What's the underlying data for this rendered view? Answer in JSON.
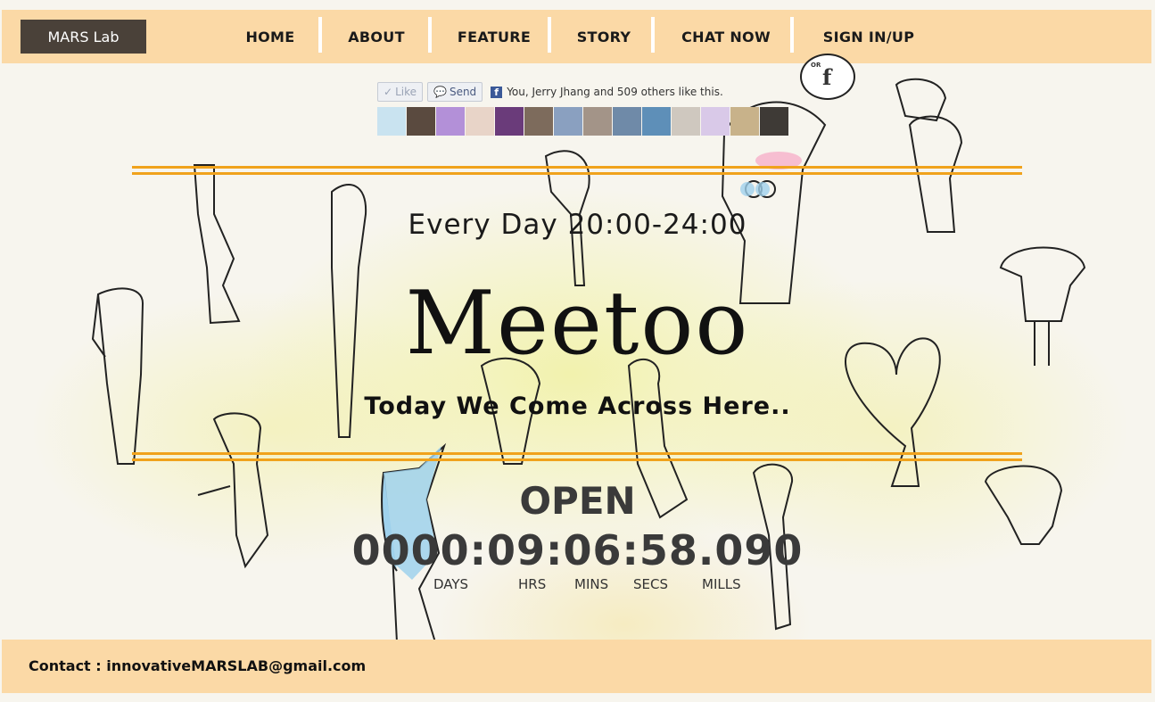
{
  "nav": {
    "brand": "MARS Lab",
    "items": [
      {
        "label": "HOME"
      },
      {
        "label": "ABOUT"
      },
      {
        "label": "FEATURE"
      },
      {
        "label": "STORY"
      },
      {
        "label": "CHAT NOW"
      },
      {
        "label": "SIGN IN/UP"
      }
    ],
    "fb_bubble_or": "OR",
    "fb_bubble_letter": "f"
  },
  "facebook": {
    "like_label": "Like",
    "send_label": "Send",
    "social_text": "You, Jerry Jhang and 509 others like this.",
    "logo_letter": "f"
  },
  "hero": {
    "tagline": "Every Day 20:00-24:00",
    "title": "Meetoo",
    "subtitle": "Today We Come Across Here.."
  },
  "countdown": {
    "status": "OPEN",
    "value": "0000:09:06:58.090",
    "units": [
      "DAYS",
      "HRS",
      "MINS",
      "SECS",
      "MILLS"
    ]
  },
  "footer": {
    "contact": "Contact : innovativeMARSLAB@gmail.com"
  },
  "colors": {
    "nav_bg": "#fbd9a6",
    "brand_bg": "#4a4139",
    "accent_line": "#f0a21c",
    "wash": "#eef078"
  }
}
